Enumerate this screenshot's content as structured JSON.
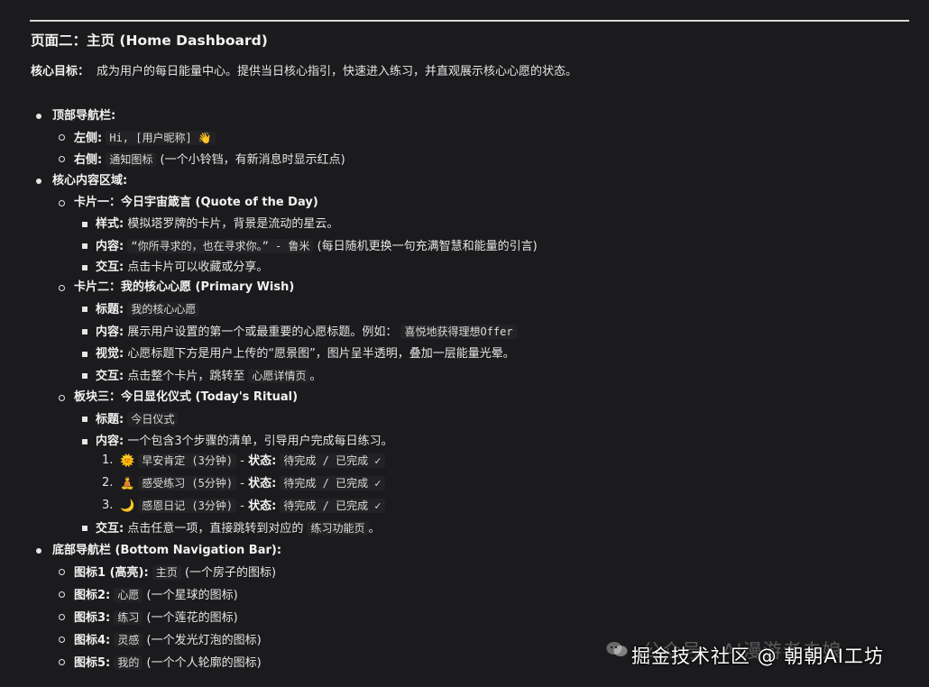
{
  "title": "页面二：主页 (Home Dashboard)",
  "goal": {
    "label": "核心目标：",
    "text": "成为用户的每日能量中心。提供当日核心指引，快速进入练习，并直观展示核心心愿的状态。"
  },
  "top_nav": {
    "label": "顶部导航栏:",
    "left": {
      "label": "左侧:",
      "value": "Hi, [用户昵称] 👋"
    },
    "right": {
      "label": "右侧:",
      "value": "通知图标",
      "note": " (一个小铃铛，有新消息时显示红点)"
    }
  },
  "core": {
    "label": "核心内容区域:",
    "card1": {
      "label": "卡片一：今日宇宙箴言 (Quote of the Day)",
      "style": {
        "label": "样式:",
        "text": " 模拟塔罗牌的卡片，背景是流动的星云。"
      },
      "content": {
        "label": "内容:",
        "value": "“你所寻求的，也在寻求你。” - 鲁米",
        "note": " (每日随机更换一句充满智慧和能量的引言)"
      },
      "interact": {
        "label": "交互:",
        "text": " 点击卡片可以收藏或分享。"
      }
    },
    "card2": {
      "label": "卡片二：我的核心心愿 (Primary Wish)",
      "title": {
        "label": "标题:",
        "value": "我的核心心愿"
      },
      "content": {
        "label": "内容:",
        "text": " 展示用户设置的第一个或最重要的心愿标题。例如：",
        "value": "喜悦地获得理想Offer"
      },
      "visual": {
        "label": "视觉:",
        "text": " 心愿标题下方是用户上传的“愿景图”，图片呈半透明，叠加一层能量光晕。"
      },
      "interact": {
        "label": "交互:",
        "text": " 点击整个卡片，跳转至",
        "value": "心愿详情页",
        "end": "。"
      }
    },
    "block3": {
      "label": "板块三：今日显化仪式 (Today's Ritual)",
      "title": {
        "label": "标题:",
        "value": "今日仪式"
      },
      "content": {
        "label": "内容:",
        "text": " 一个包含3个步骤的清单，引导用户完成每日练习。"
      },
      "steps": [
        {
          "num": "1.",
          "emoji": "🌞",
          "name": "早安肯定 (3分钟)",
          "sep": " - ",
          "status_label": "状态:",
          "status": "待完成 / 已完成 ✓"
        },
        {
          "num": "2.",
          "emoji": "🧘",
          "name": "感受练习 (5分钟)",
          "sep": " - ",
          "status_label": "状态:",
          "status": "待完成 / 已完成 ✓"
        },
        {
          "num": "3.",
          "emoji": "🌙",
          "name": "感恩日记 (3分钟)",
          "sep": " - ",
          "status_label": "状态:",
          "status": "待完成 / 已完成 ✓"
        }
      ],
      "interact": {
        "label": "交互:",
        "text": " 点击任意一项，直接跳转到对应的",
        "value": "练习功能页",
        "end": "。"
      }
    }
  },
  "bottom_nav": {
    "label": "底部导航栏 (Bottom Navigation Bar):",
    "icons": [
      {
        "label": "图标1 (高亮):",
        "value": "主页",
        "note": " (一个房子的图标)"
      },
      {
        "label": "图标2:",
        "value": "心愿",
        "note": " (一个星球的图标)"
      },
      {
        "label": "图标3:",
        "value": "练习",
        "note": " (一个莲花的图标)"
      },
      {
        "label": "图标4:",
        "value": "灵感",
        "note": " (一个发光灯泡的图标)"
      },
      {
        "label": "图标5:",
        "value": "我的",
        "note": " (一个个人轮廓的图标)"
      }
    ]
  },
  "watermark": {
    "faded": "公众号 · AI漫游者去娘",
    "main": "掘金技术社区 @ 朝朝AI工坊"
  }
}
